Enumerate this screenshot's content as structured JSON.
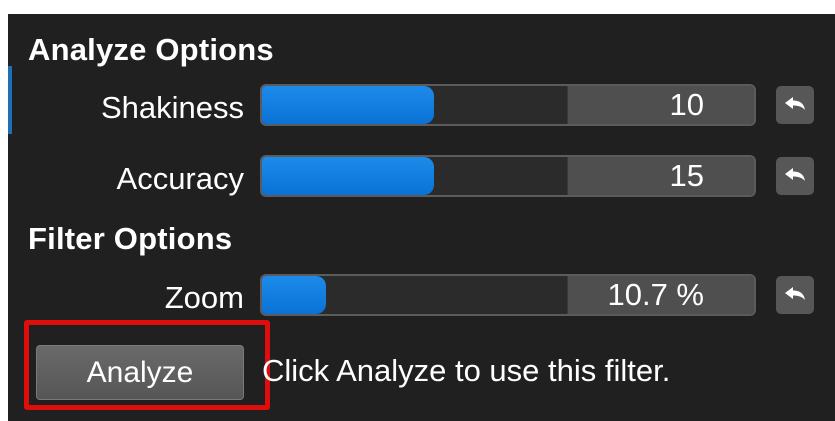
{
  "analyze_options": {
    "title": "Analyze Options",
    "shakiness": {
      "label": "Shakiness",
      "value": "10",
      "fill_fraction": 0.35,
      "reset_icon": "reset-arrow-icon"
    },
    "accuracy": {
      "label": "Accuracy",
      "value": "15",
      "fill_fraction": 0.35,
      "reset_icon": "reset-arrow-icon"
    }
  },
  "filter_options": {
    "title": "Filter Options",
    "zoom": {
      "label": "Zoom",
      "value": "10.7 %",
      "fill_fraction": 0.13,
      "reset_icon": "reset-arrow-icon"
    }
  },
  "actions": {
    "analyze_label": "Analyze",
    "hint": "Click Analyze to use this filter."
  },
  "colors": {
    "panel_bg": "#202020",
    "accent": "#1480e2",
    "highlight": "#e00d0d"
  }
}
